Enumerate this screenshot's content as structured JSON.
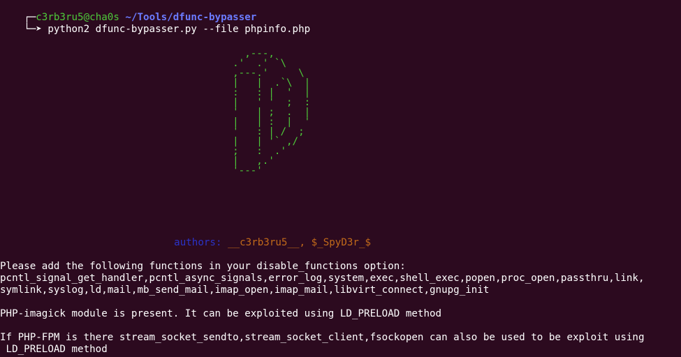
{
  "prompt": {
    "corner_top": "┌─",
    "user": "c3rb3ru5",
    "at": "@",
    "host": "cha0s",
    "path": "~/Tools/dfunc-bypasser",
    "corner_bottom": "└─➤",
    "command": "python2 dfunc-bypasser.py --file phpinfo.php"
  },
  "banner": {
    "ascii_art": "                                         ,---,\n                                       .'  .' `\\\n                                       ,---.'     \\\n                                       |   |  .`\\  |\n                                       :   : |  '  |\n                                       |   ' '  ;  :\n                                       '   | ;  .  |\n                                       |   | :  |  '\n                                       '   : | /  ;\n                                       |   | '` ,/\n                                       ;   :  .'\n                                       |   ,.'\n                                       '---'",
    "authors_label": "authors:",
    "authors_value": "__c3rb3ru5__, $_SpyD3r_$"
  },
  "output": {
    "line1": "Please add the following functions in your disable_functions option:",
    "line2": "pcntl_signal_get_handler,pcntl_async_signals,error_log,system,exec,shell_exec,popen,proc_open,passthru,link,",
    "line3": "symlink,syslog,ld,mail,mb_send_mail,imap_open,imap_mail,libvirt_connect,gnupg_init",
    "line4": "PHP-imagick module is present. It can be exploited using LD_PRELOAD method",
    "line5": "If PHP-FPM is there stream_socket_sendto,stream_socket_client,fsockopen can also be used to be exploit using",
    "line6": " LD_PRELOAD method"
  },
  "colors": {
    "background": "#2c0a1f",
    "user": "#4ec93a",
    "path": "#6b7bff",
    "ascii": "#4ec93a",
    "authors_label": "#2b33c9",
    "authors_value": "#c26a1a"
  }
}
